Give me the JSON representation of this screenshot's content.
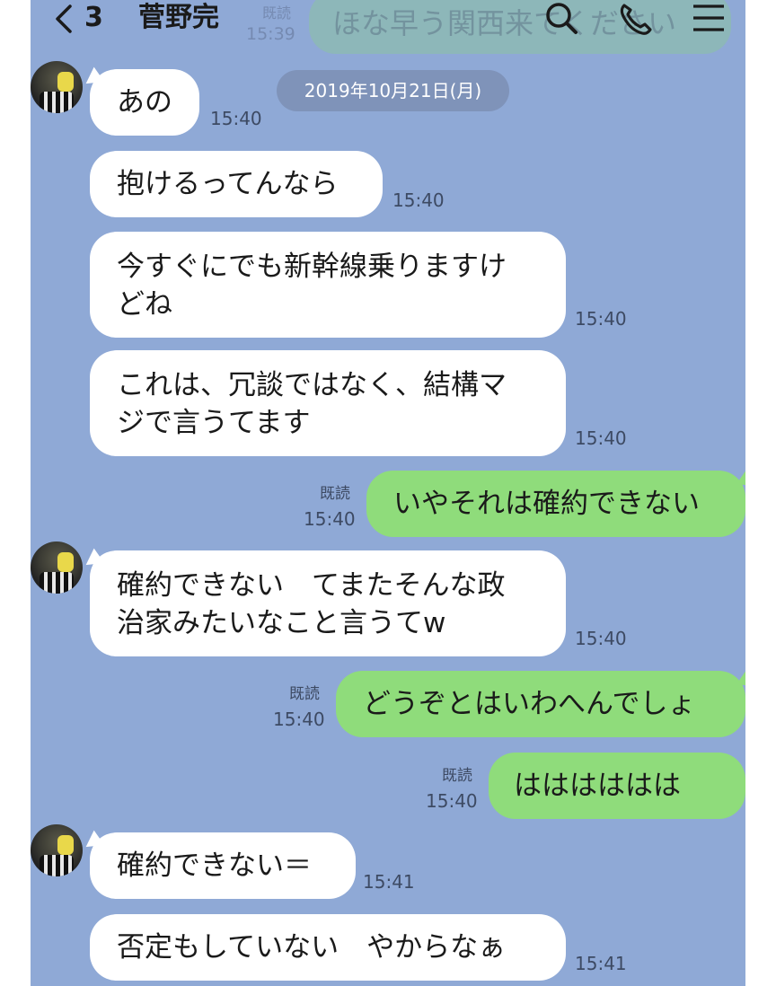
{
  "header": {
    "unread_count": "3",
    "title": "菅野完",
    "ghost_read_label": "既読",
    "ghost_time": "15:39",
    "ghost_message": "ほな早う関西来てください"
  },
  "date_chip": "2019年10月21日(月)",
  "colors": {
    "background": "#8fa9d6",
    "incoming_bubble": "#ffffff",
    "outgoing_bubble": "#8fdc7b",
    "date_chip": "#7f93b9"
  },
  "icons": [
    "back-chevron-icon",
    "search-icon",
    "phone-icon",
    "menu-icon"
  ],
  "messages": [
    {
      "from": "them",
      "text": "あの",
      "time": "15:40"
    },
    {
      "from": "them",
      "text": "抱けるってんなら",
      "time": "15:40"
    },
    {
      "from": "them",
      "text": "今すぐにでも新幹線乗りますけ\nどね",
      "time": "15:40"
    },
    {
      "from": "them",
      "text": "これは、冗談ではなく、結構マ\nジで言うてます",
      "time": "15:40"
    },
    {
      "from": "me",
      "text": "いやそれは確約できない",
      "time": "15:40",
      "read": "既読"
    },
    {
      "from": "them",
      "text": "確約できない　てまたそんな政\n治家みたいなこと言うてw",
      "time": "15:40"
    },
    {
      "from": "me",
      "text": "どうぞとはいわへんでしょ",
      "time": "15:40",
      "read": "既読"
    },
    {
      "from": "me",
      "text": "はははははは",
      "time": "15:40",
      "read": "既読"
    },
    {
      "from": "them",
      "text": "確約できない＝",
      "time": "15:41"
    },
    {
      "from": "them",
      "text": "否定もしていない　やからなぁ",
      "time": "15:41"
    }
  ]
}
